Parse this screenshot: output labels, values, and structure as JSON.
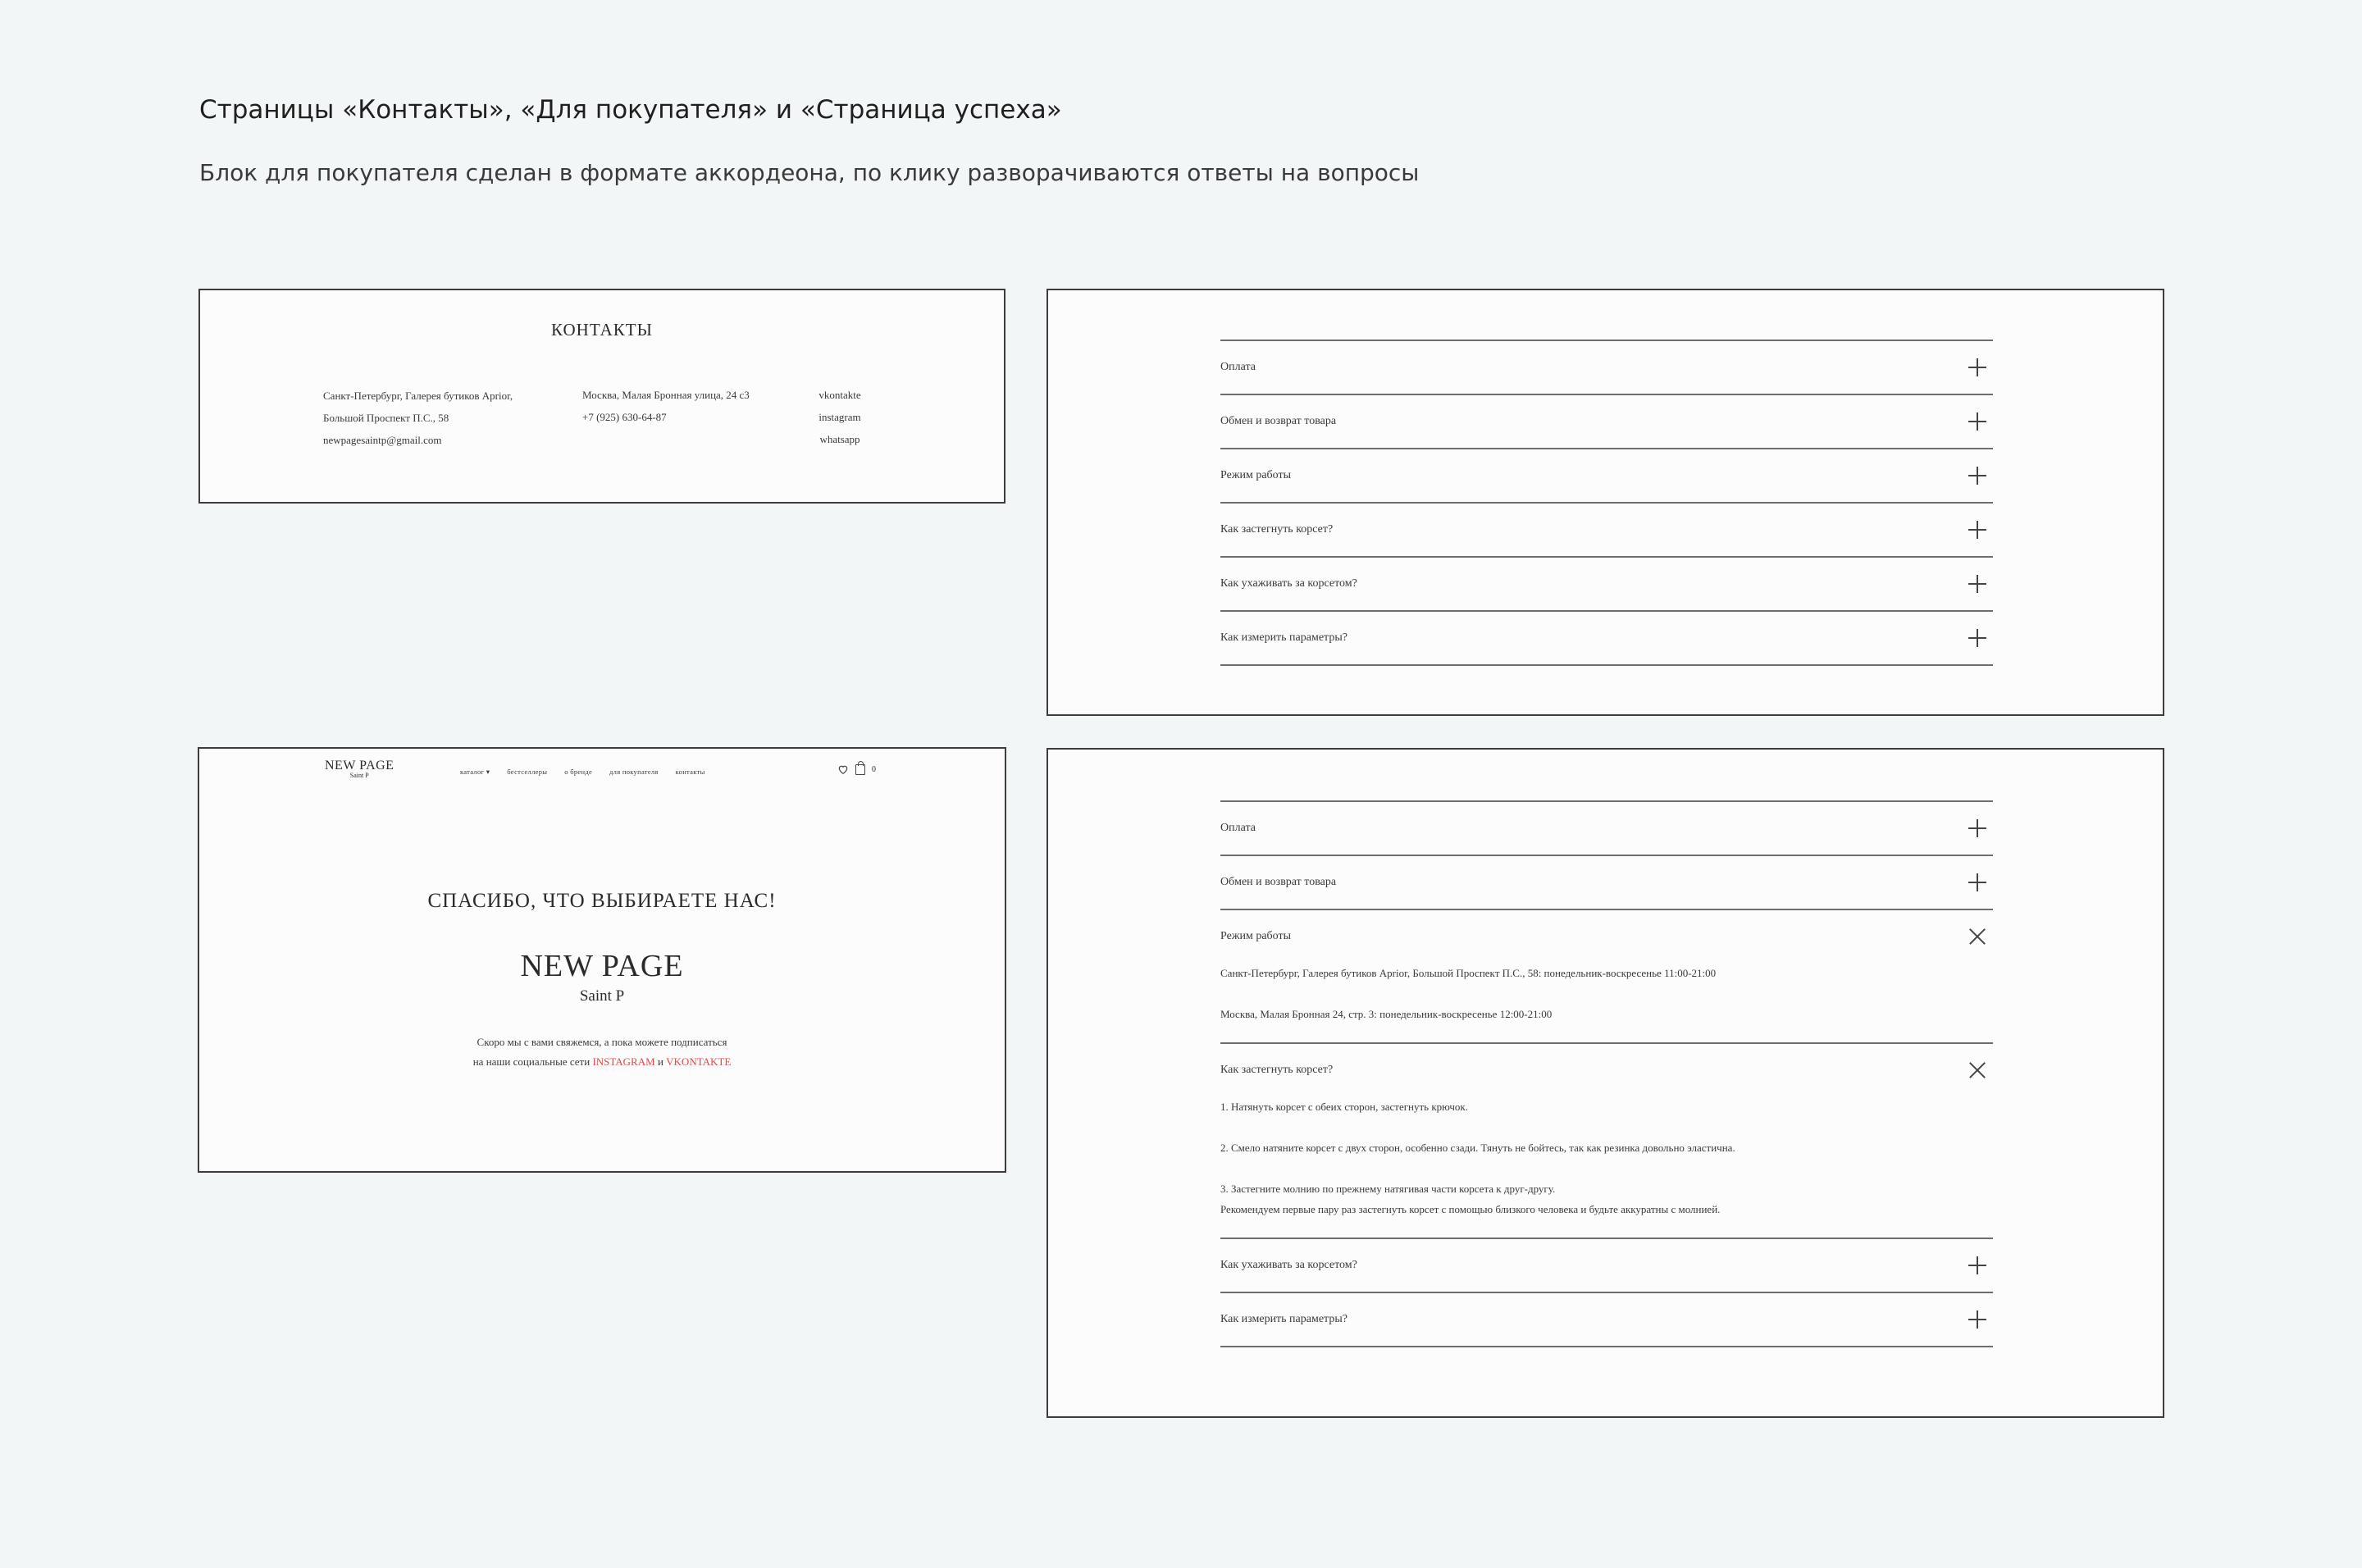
{
  "header": {
    "title": "Страницы «Контакты», «Для покупателя» и «Страница успеха»",
    "subtitle": "Блок для покупателя сделан в формате аккордеона, по клику разворачиваются ответы на вопросы"
  },
  "contacts": {
    "title": "КОНТАКТЫ",
    "address_1": "Санкт-Петербург, Галерея бутиков Aprior,",
    "address_2": "Большой Проспект П.С., 58",
    "email": "newpagesaintp@gmail.com",
    "moscow_address": "Москва, Малая Бронная улица, 24 с3",
    "phone": "+7 (925) 630-64-87",
    "social_1": "vkontakte",
    "social_2": "instagram",
    "social_3": "whatsapp"
  },
  "faq_collapsed": {
    "items": [
      {
        "label": "Оплата"
      },
      {
        "label": "Обмен и возврат товара"
      },
      {
        "label": "Режим работы"
      },
      {
        "label": "Как застегнуть корсет?"
      },
      {
        "label": "Как ухаживать за корсетом?"
      },
      {
        "label": "Как измерить параметры?"
      }
    ]
  },
  "faq_expanded": {
    "items": [
      {
        "label": "Оплата"
      },
      {
        "label": "Обмен и возврат товара"
      },
      {
        "label": "Режим работы",
        "lines": [
          "Санкт-Петербург, Галерея бутиков Aprior, Большой Проспект П.С., 58: понедельник-воскресенье 11:00-21:00",
          "Москва, Малая Бронная 24, стр. 3: понедельник-воскресенье 12:00-21:00"
        ]
      },
      {
        "label": "Как застегнуть корсет?",
        "lines": [
          "1. Натянуть корсет с обеих сторон, застегнуть крючок.",
          "2. Смело натяните корсет с двух сторон, особенно сзади. Тянуть не бойтесь, так как резинка довольно эластична.",
          "3. Застегните молнию по прежнему натягивая части корсета к друг-другу.",
          "Рекомендуем первые пару раз застегнуть корсет с помощью близкого человека и будьте аккуратны с молнией."
        ]
      },
      {
        "label": "Как ухаживать за корсетом?"
      },
      {
        "label": "Как измерить параметры?"
      }
    ]
  },
  "success": {
    "logo_main": "NEW PAGE",
    "logo_sub": "Saint P",
    "nav": [
      "каталог ▾",
      "бестселлеры",
      "о бренде",
      "для покупателя",
      "контакты"
    ],
    "cart_count": "0",
    "thanks": "СПАСИБО, ЧТО ВЫБИРАЕТЕ НАС!",
    "brand": "NEW PAGE",
    "brand_sub": "Saint P",
    "text_line_1": "Скоро мы с вами свяжемся, а пока можете подписаться",
    "text_line_2_prefix": "на наши социальные сети",
    "link_instagram": "INSTAGRAM",
    "text_and": "и",
    "link_vkontakte": "VKONTAKTE",
    "accent_color": "#e04a4a"
  }
}
